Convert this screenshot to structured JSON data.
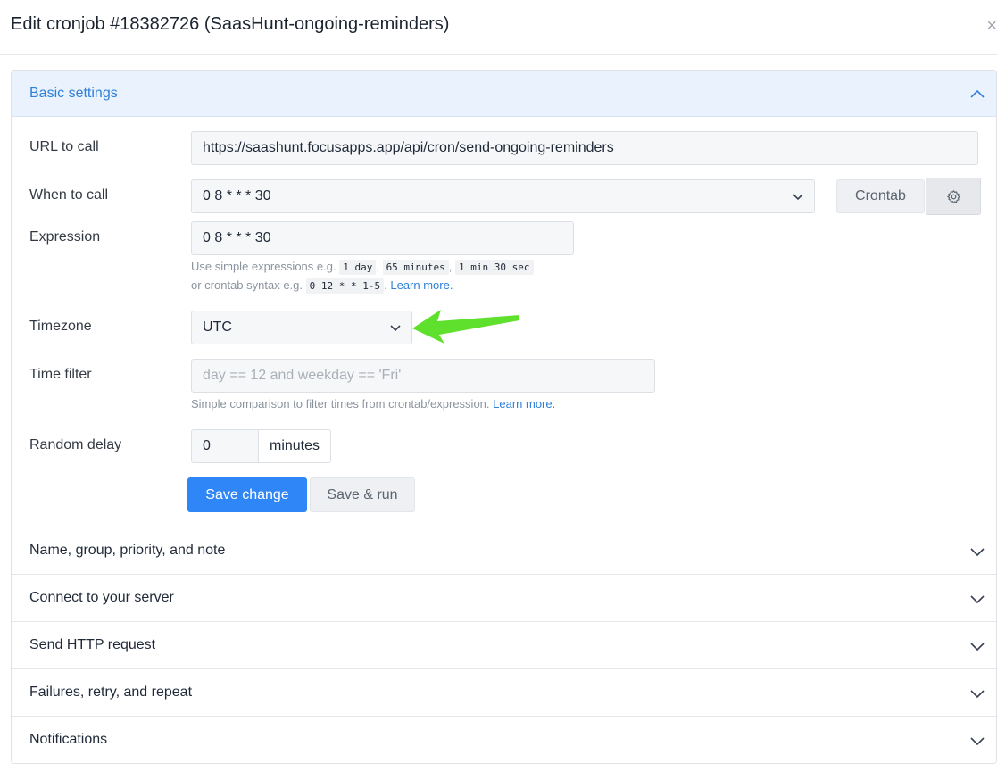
{
  "modal": {
    "title": "Edit cronjob #18382726 (SaasHunt-ongoing-reminders)",
    "close_glyph": "×"
  },
  "basic_settings": {
    "header": "Basic settings",
    "url": {
      "label": "URL to call",
      "value": "https://saashunt.focusapps.app/api/cron/send-ongoing-reminders"
    },
    "when": {
      "label": "When to call",
      "value": "0 8 * * * 30",
      "mode_button": "Crontab",
      "gear_icon": "gear-icon"
    },
    "expression": {
      "label": "Expression",
      "value": "0 8 * * * 30",
      "help_line1_prefix": "Use simple expressions e.g.",
      "examples": [
        "1 day",
        "65 minutes",
        "1 min 30 sec"
      ],
      "help_line2_prefix": "or crontab syntax e.g.",
      "crontab_example": "0 12 * * 1-5",
      "learn_more": "Learn more."
    },
    "timezone": {
      "label": "Timezone",
      "value": "UTC"
    },
    "time_filter": {
      "label": "Time filter",
      "placeholder": "day == 12 and weekday == 'Fri'",
      "help": "Simple comparison to filter times from crontab/expression.",
      "learn_more": "Learn more."
    },
    "random_delay": {
      "label": "Random delay",
      "value": "0",
      "unit": "minutes"
    },
    "save_button": "Save change",
    "save_run_button": "Save & run"
  },
  "sections": [
    {
      "label": "Name, group, priority, and note"
    },
    {
      "label": "Connect to your server"
    },
    {
      "label": "Send HTTP request"
    },
    {
      "label": "Failures, retry, and repeat"
    },
    {
      "label": "Notifications"
    }
  ],
  "colors": {
    "accent_blue": "#2f86f6",
    "link_blue": "#2f80d9",
    "arrow_green": "#5ee02c",
    "header_bg": "#e9f2fd"
  }
}
